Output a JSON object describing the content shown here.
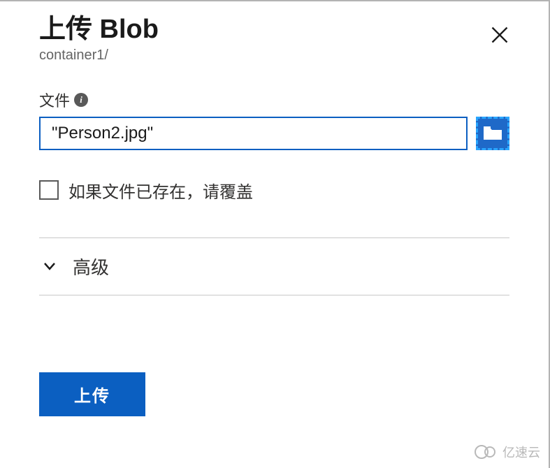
{
  "header": {
    "title": "上传 Blob",
    "breadcrumb": "container1/"
  },
  "fileField": {
    "label": "文件",
    "value": "\"Person2.jpg\""
  },
  "overwrite": {
    "label": "如果文件已存在，请覆盖",
    "checked": false
  },
  "advanced": {
    "label": "高级",
    "expanded": false
  },
  "actions": {
    "upload_label": "上传"
  },
  "icons": {
    "close": "close-icon",
    "info": "info-icon",
    "browse": "folder-icon",
    "chevron": "chevron-down-icon"
  },
  "watermark": {
    "text": "亿速云"
  },
  "colors": {
    "primary": "#0b5fc1",
    "accent_dash": "#2aa6ff",
    "text": "#323130",
    "muted": "#646464"
  }
}
